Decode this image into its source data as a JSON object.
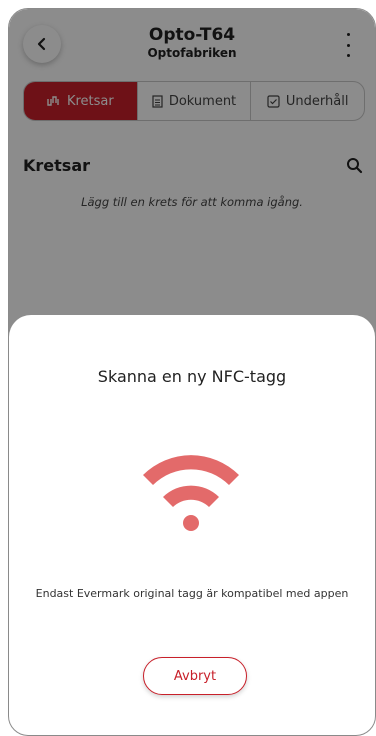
{
  "header": {
    "title": "Opto-T64",
    "subtitle": "Optofabriken"
  },
  "tabs": [
    {
      "label": "Kretsar",
      "icon": "circuit-icon",
      "active": true
    },
    {
      "label": "Dokument",
      "icon": "document-icon",
      "active": false
    },
    {
      "label": "Underhåll",
      "icon": "checkbox-icon",
      "active": false
    }
  ],
  "section": {
    "title": "Kretsar",
    "empty_hint": "Lägg till en krets för att komma igång."
  },
  "nfc_sheet": {
    "title": "Skanna en ny NFC-tagg",
    "compat_text": "Endast Evermark original tagg är kompatibel med appen",
    "cancel_label": "Avbryt"
  },
  "colors": {
    "accent": "#c8202a",
    "nfc_icon": "#e36a6a",
    "overlay": "rgba(0,0,0,0.45)"
  }
}
